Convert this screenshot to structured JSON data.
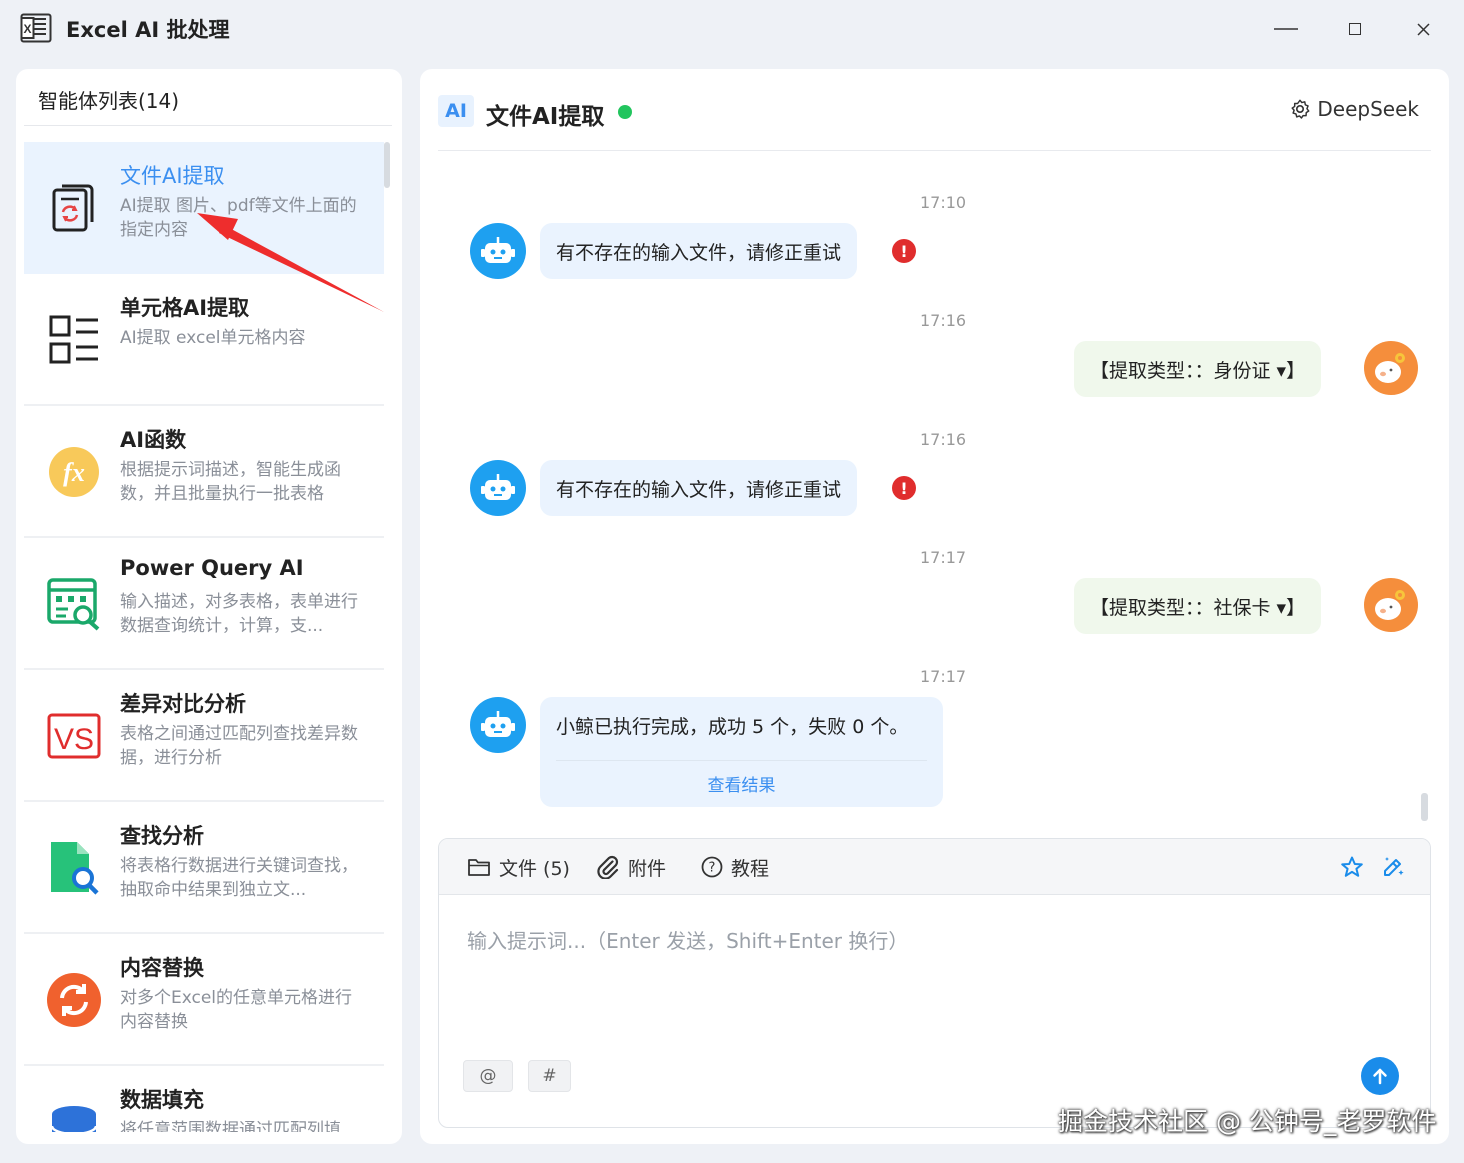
{
  "app": {
    "title": "Excel AI 批处理",
    "icon": "excel-doc-icon"
  },
  "window_controls": {
    "minimize_icon": "minimize-icon",
    "maximize_icon": "maximize-icon",
    "close_icon": "close-icon"
  },
  "sidebar": {
    "header": "智能体列表(14)",
    "items": [
      {
        "title": "文件AI提取",
        "desc": "AI提取 图片、pdf等文件上面的指定内容",
        "icon": "document-refresh-icon",
        "active": true
      },
      {
        "title": "单元格AI提取",
        "desc": "AI提取 excel单元格内容",
        "icon": "grid-list-icon"
      },
      {
        "title": "AI函数",
        "desc": "根据提示词描述，智能生成函数，并且批量执行一批表格",
        "icon": "fx-function-icon"
      },
      {
        "title": "Power Query AI",
        "desc": "输入描述，对多表格，表单进行数据查询统计，计算，支...",
        "icon": "table-search-icon"
      },
      {
        "title": "差异对比分析",
        "desc": "表格之间通过匹配列查找差异数据，进行分析",
        "icon": "vs-icon"
      },
      {
        "title": "查找分析",
        "desc": "将表格行数据进行关键词查找，抽取命中结果到独立文...",
        "icon": "file-search-icon"
      },
      {
        "title": "内容替换",
        "desc": "对多个Excel的任意单元格进行内容替换",
        "icon": "replace-refresh-icon"
      },
      {
        "title": "数据填充",
        "desc": "将任意范围数据通过匹配列填",
        "icon": "database-icon"
      }
    ]
  },
  "chat": {
    "ai_badge": "AI",
    "title": "文件AI提取",
    "status_color": "#22c55e",
    "model_label": "DeepSeek",
    "model_icon": "gear-icon",
    "messages": [
      {
        "time": "17:10",
        "role": "bot",
        "text": "有不存在的输入文件，请修正重试",
        "error": true
      },
      {
        "time": "17:16",
        "role": "user",
        "text": "【提取类型：：身份证 ▾】"
      },
      {
        "time": "17:16",
        "role": "bot",
        "text": "有不存在的输入文件，请修正重试",
        "error": true
      },
      {
        "time": "17:17",
        "role": "user",
        "text": "【提取类型：：社保卡 ▾】"
      },
      {
        "time": "17:17",
        "role": "bot",
        "text": "小鲸已执行完成，成功 5 个，失败 0 个。",
        "link": "查看结果"
      }
    ],
    "error_glyph": "!"
  },
  "composer": {
    "files_label": "文件 (5)",
    "attach_label": "附件",
    "tutorial_label": "教程",
    "placeholder": "输入提示词...（Enter 发送，Shift+Enter 换行）",
    "mention_chip": "@",
    "hash_chip": "#",
    "star_icon": "star-icon",
    "magic_edit_icon": "magic-pen-icon",
    "send_icon": "arrow-up-icon"
  },
  "colors": {
    "accent": "#3b8ff0",
    "bot_avatar": "#1ea0f0",
    "user_avatar": "#f58e3c",
    "bot_bubble": "#eaf3fe",
    "user_bubble": "#f0f8ec",
    "error": "#e02d2d",
    "annotation_arrow": "#ee2d2d"
  },
  "watermark": "掘金技术社区 @ 公钟号_老罗软件"
}
